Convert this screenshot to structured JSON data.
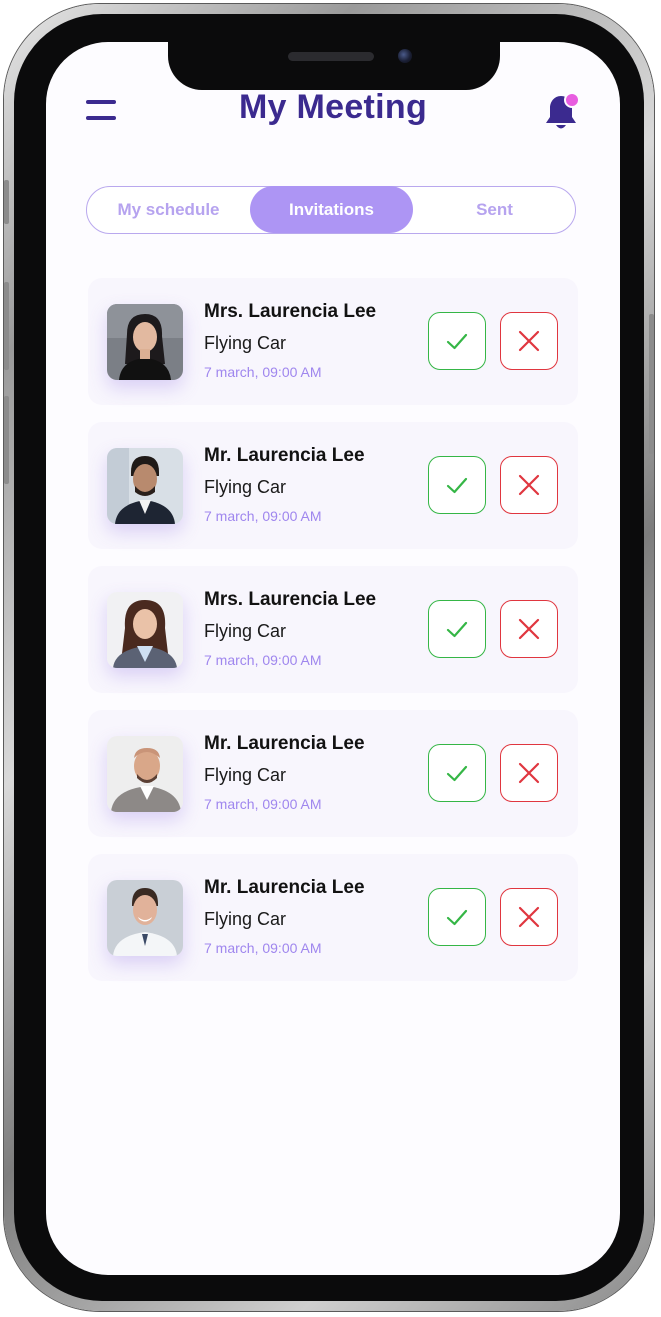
{
  "header": {
    "title": "My Meeting",
    "menu_icon": "hamburger-menu-icon",
    "notification_icon": "bell-icon",
    "notification_badge_color": "#e85de0"
  },
  "tabs": [
    {
      "label": "My schedule",
      "active": false
    },
    {
      "label": "Invitations",
      "active": true
    },
    {
      "label": "Sent",
      "active": false
    }
  ],
  "invitations": [
    {
      "name": "Mrs. Laurencia Lee",
      "subject": "Flying Car",
      "datetime": "7 march, 09:00 AM"
    },
    {
      "name": "Mr. Laurencia Lee",
      "subject": "Flying Car",
      "datetime": "7 march, 09:00 AM"
    },
    {
      "name": "Mrs. Laurencia Lee",
      "subject": "Flying Car",
      "datetime": "7 march, 09:00 AM"
    },
    {
      "name": "Mr. Laurencia Lee",
      "subject": "Flying Car",
      "datetime": "7 march, 09:00 AM"
    },
    {
      "name": "Mr. Laurencia Lee",
      "subject": "Flying Car",
      "datetime": "7 march, 09:00 AM"
    }
  ],
  "colors": {
    "brand": "#3b2a8f",
    "accent": "#ad95f4",
    "accept": "#35b646",
    "reject": "#e0363f"
  }
}
